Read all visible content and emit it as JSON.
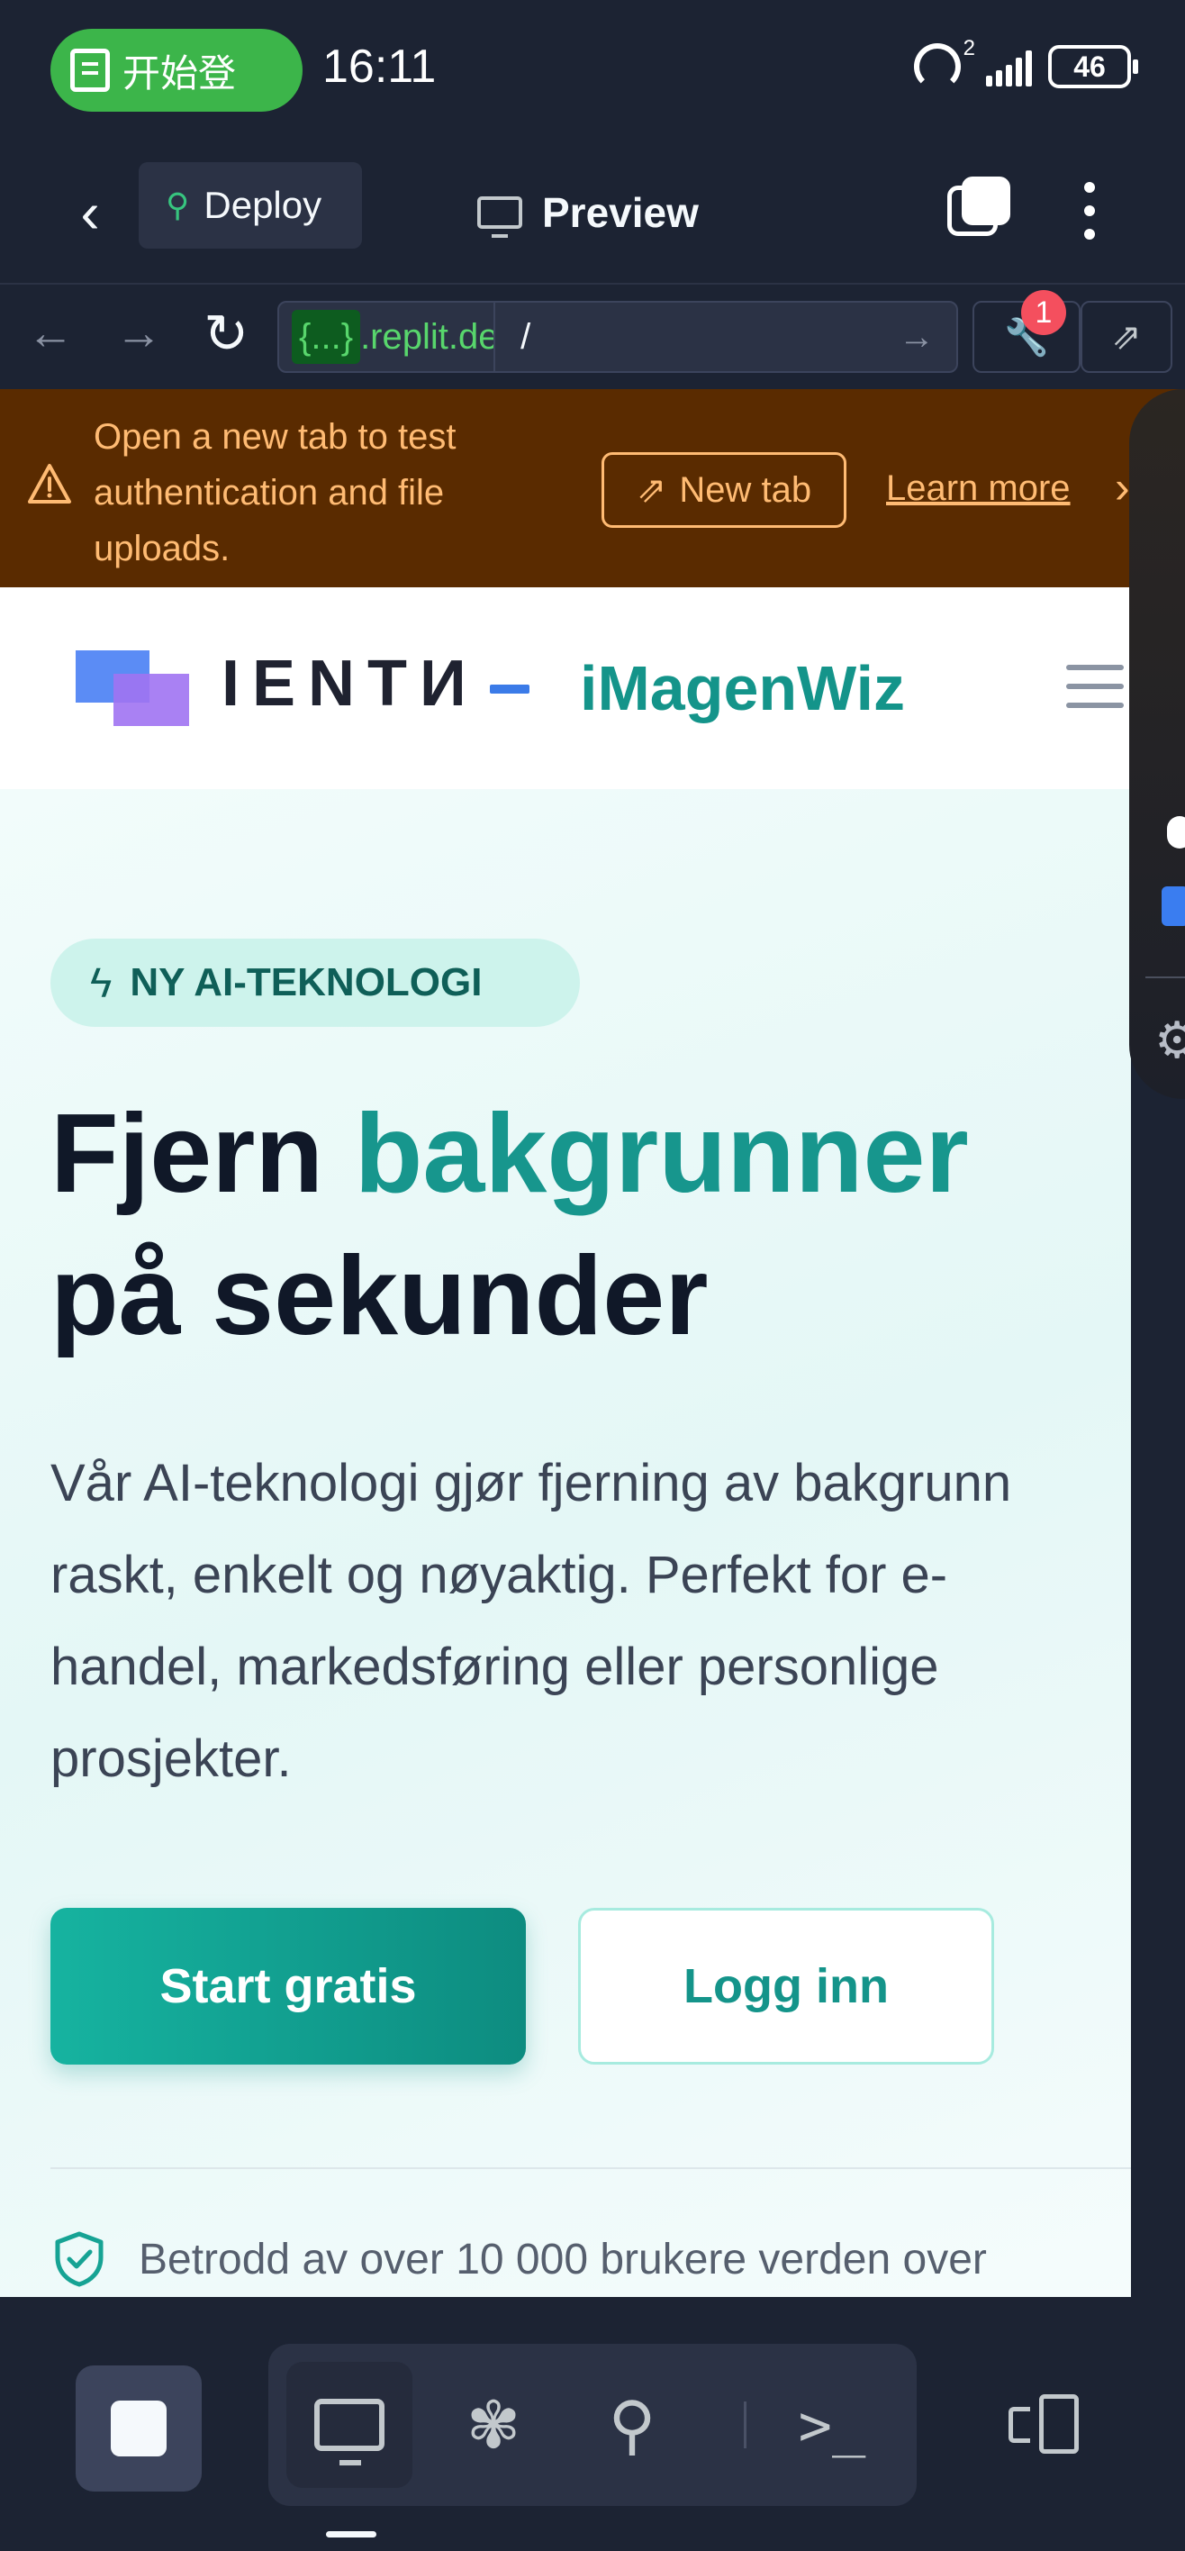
{
  "status_bar": {
    "call_text": "开始登",
    "time": "16:11",
    "hotspot_sup": "2",
    "battery": "46"
  },
  "toolbar": {
    "deploy_label": "Deploy",
    "preview_label": "Preview"
  },
  "urlbar": {
    "prefix": "{...}",
    "domain": ".replit.de",
    "path": "/",
    "devtools_badge": "1"
  },
  "banner": {
    "message": "Open a new tab to test authentication and file uploads.",
    "new_tab_label": "New tab",
    "learn_more_label": "Learn more"
  },
  "site": {
    "brand_mark": "IENTИ",
    "brand_name": "iMagenWiz",
    "badge": "NY AI-TEKNOLOGI",
    "headline_part1": "Fjern ",
    "headline_accent": "bakgrunner",
    "headline_part2": "på sekunder",
    "lead": "Vår AI-teknologi gjør fjerning av bakgrunn raskt, enkelt og nøyaktig. Perfekt for e-handel, markedsføring eller personlige prosjekter.",
    "cta_primary": "Start gratis",
    "cta_secondary": "Logg inn",
    "trust_text": "Betrodd av over 10 000 brukere verden over"
  },
  "colors": {
    "app_bg": "#1c2333",
    "banner_bg": "#5a2b00",
    "banner_text": "#ffbb73",
    "brand_teal": "#17968d",
    "call_pill": "#3cb54a"
  },
  "icons": {
    "back": "chevron-left-icon",
    "deploy": "deploy-tree-icon",
    "preview": "monitor-icon",
    "warning": "warning-triangle-icon",
    "shield": "shield-check-icon"
  }
}
